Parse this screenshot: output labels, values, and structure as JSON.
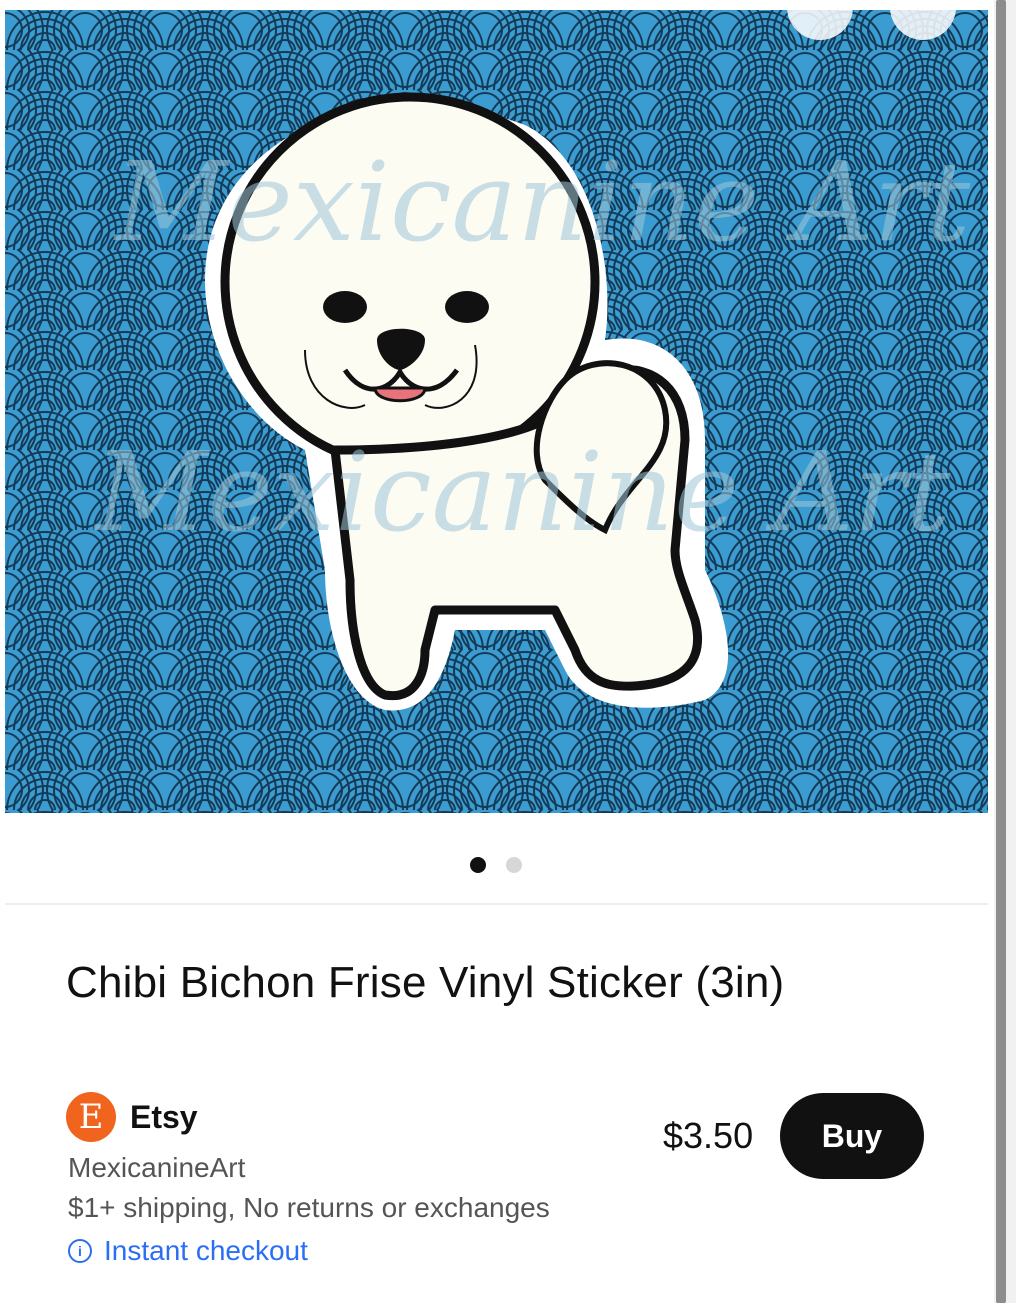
{
  "product": {
    "title": "Chibi Bichon Frise Vinyl Sticker (3in)",
    "price": "$3.50",
    "buy_label": "Buy"
  },
  "merchant": {
    "logo_letter": "E",
    "name": "Etsy",
    "seller": "MexicanineArt",
    "shipping": "$1+ shipping, No returns or exchanges",
    "checkout_label": "Instant checkout"
  },
  "image": {
    "watermark": "Mexicanine Art",
    "icon": "chibi-bichon-sticker",
    "pattern_bg": "#3a9cd1",
    "pattern_line": "#153a55"
  },
  "carousel": {
    "total": 2,
    "current": 1
  },
  "colors": {
    "etsy_orange": "#f1641e",
    "link_blue": "#2a6ef5",
    "buy_bg": "#111111"
  }
}
